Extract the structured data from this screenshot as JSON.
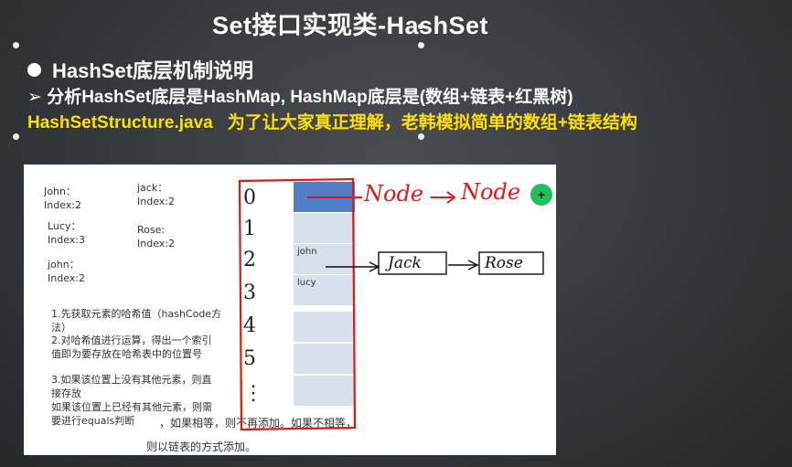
{
  "slide": {
    "title": "Set接口实现类-HashSet",
    "bullet1": "HashSet底层机制说明",
    "bullet2": "➢ 分析HashSet底层是HashMap, HashMap底层是(数组+链表+红黑树)",
    "bullet3_file": "HashSetStructure.java",
    "bullet3_text": "为了让大家真正理解，老韩模拟简单的数组+链表结构"
  },
  "panel": {
    "entries": [
      {
        "name": "John：",
        "index": "Index:2"
      },
      {
        "name": "jack：",
        "index": "Index:2"
      },
      {
        "name": "Lucy：",
        "index": "Index:3"
      },
      {
        "name": "Rose:",
        "index": "Index:2"
      },
      {
        "name": "john：",
        "index": "Index:2"
      }
    ],
    "steps": {
      "s1a": "1.先获取元素的哈希值（hashCode方",
      "s1b": "法）",
      "s2a": "2.对哈希值进行运算，得出一个索引",
      "s2b": "值即为要存放在哈希表中的位置号",
      "s3a": "3.如果该位置上没有其他元素，则直",
      "s3b": "接存放",
      "s3c": "如果该位置上已经有其他元素，则需",
      "s3d": "要进行equals判断",
      "s3e": "，如果相等，则不再添加。如果不相等，",
      "s3f": "则以链表的方式添加。"
    },
    "table_cells": [
      "",
      "",
      "john",
      "lucy",
      "",
      "",
      ""
    ],
    "indices": [
      "0",
      "1",
      "2",
      "3",
      "4",
      "5",
      "⋮"
    ],
    "handwriting": {
      "node1": "Node",
      "node2": "Node",
      "jack": "Jack",
      "rose": "Rose"
    },
    "plus": "+"
  },
  "colors": {
    "title": "#ffffff",
    "highlight": "#ffe000",
    "cell_top": "#4f7fc6",
    "cell": "#d8e0ed",
    "ink_red": "#e01818"
  }
}
